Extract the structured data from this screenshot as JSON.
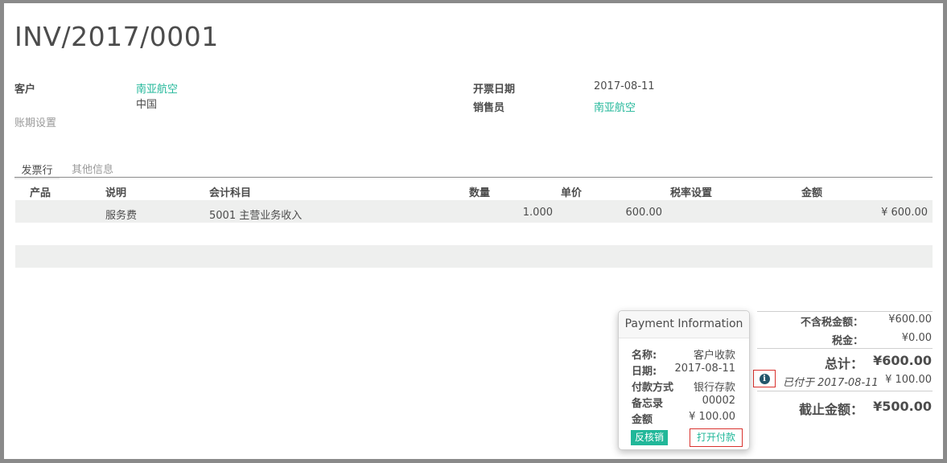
{
  "invoice": {
    "number": "INV/2017/0001"
  },
  "header": {
    "customer_label": "客户",
    "customer_name": "南亚航空",
    "customer_country": "中国",
    "payment_terms_label": "账期设置",
    "invoice_date_label": "开票日期",
    "invoice_date": "2017-08-11",
    "salesperson_label": "销售员",
    "salesperson": "南亚航空"
  },
  "tabs": [
    {
      "label": "发票行",
      "active": true
    },
    {
      "label": "其他信息",
      "active": false
    }
  ],
  "table": {
    "columns": [
      "产品",
      "说明",
      "会计科目",
      "数量",
      "单价",
      "税率设置",
      "金额"
    ],
    "rows": [
      {
        "product": "",
        "description": "服务费",
        "account": "5001 主营业务收入",
        "quantity": "1.000",
        "unit_price": "600.00",
        "taxes": "",
        "amount": "¥ 600.00"
      }
    ]
  },
  "totals": {
    "untaxed_label": "不含税金额：",
    "untaxed_value": "¥600.00",
    "tax_label": "税金：",
    "tax_value": "¥0.00",
    "total_label": "总计：",
    "total_value": "¥600.00",
    "paid_label": "已付于 2017-08-11",
    "paid_value": "¥ 100.00",
    "amount_due_label": "截止金额：",
    "amount_due_value": "¥500.00"
  },
  "payment_popover": {
    "title": "Payment Information",
    "fields": [
      {
        "label": "名称:",
        "value": "客户收款"
      },
      {
        "label": "日期:",
        "value": "2017-08-11"
      },
      {
        "label": "付款方式",
        "value": "银行存款"
      },
      {
        "label": "备忘录",
        "value": "00002"
      },
      {
        "label": "金额",
        "value": "¥ 100.00"
      }
    ],
    "unreconcile_label": "反核销",
    "open_payment_label": "打开付款"
  },
  "colors": {
    "link": "#21b799",
    "highlight_border": "#d9322e",
    "row_bg": "#eeefee"
  },
  "icons": {
    "payment_info": "info-circle-icon"
  }
}
